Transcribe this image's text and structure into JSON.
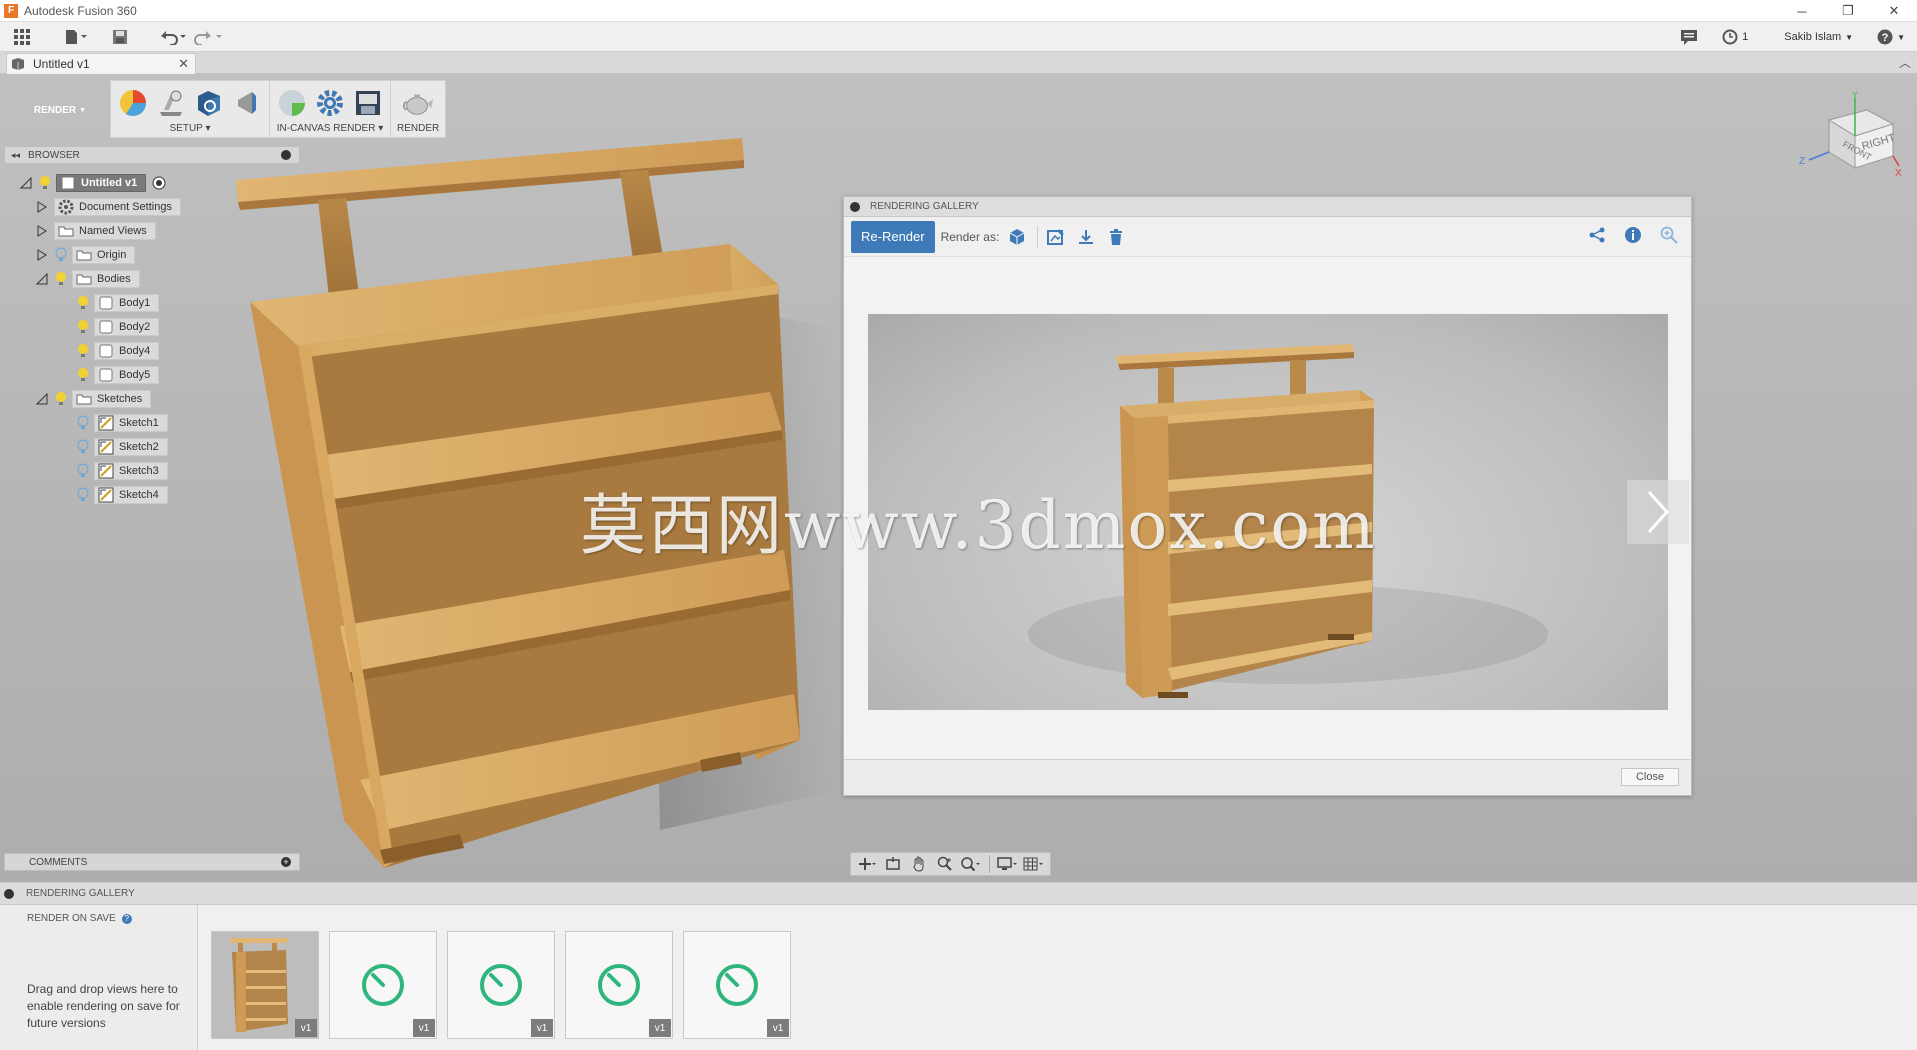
{
  "app": {
    "title": "Autodesk Fusion 360",
    "logo": "F"
  },
  "window_controls": {
    "minimize": "─",
    "restore": "❐",
    "close": "✕"
  },
  "quick_access": {
    "user": "Sakib Islam",
    "jobs_count": "1"
  },
  "document": {
    "tab_label": "Untitled v1"
  },
  "ribbon": {
    "workspace": "RENDER",
    "groups": [
      {
        "label": "SETUP"
      },
      {
        "label": "IN-CANVAS RENDER"
      },
      {
        "label": "RENDER"
      }
    ]
  },
  "browser": {
    "title": "BROWSER",
    "root": "Untitled v1",
    "items": [
      {
        "label": "Document Settings"
      },
      {
        "label": "Named Views"
      },
      {
        "label": "Origin"
      },
      {
        "label": "Bodies"
      },
      {
        "label": "Body1"
      },
      {
        "label": "Body2"
      },
      {
        "label": "Body4"
      },
      {
        "label": "Body5"
      },
      {
        "label": "Sketches"
      },
      {
        "label": "Sketch1"
      },
      {
        "label": "Sketch2"
      },
      {
        "label": "Sketch3"
      },
      {
        "label": "Sketch4"
      }
    ]
  },
  "comments": {
    "title": "COMMENTS"
  },
  "viewcube": {
    "face_right": "RIGHT",
    "face_front": "FRONT",
    "axis_z": "Z",
    "axis_x": "X",
    "axis_y": "Y"
  },
  "gallery_dialog": {
    "title": "RENDERING GALLERY",
    "rerender": "Re-Render",
    "render_as": "Render as:",
    "close": "Close"
  },
  "watermark": "莫西网www.3dmox.com",
  "strip": {
    "title": "RENDERING GALLERY",
    "render_on_save": "RENDER ON SAVE",
    "hint": "Drag and drop views here to enable rendering on save for future versions",
    "thumbs": [
      {
        "version": "v1"
      },
      {
        "version": "v1"
      },
      {
        "version": "v1"
      },
      {
        "version": "v1"
      },
      {
        "version": "v1"
      }
    ]
  },
  "colors": {
    "accent": "#3e7ab8",
    "wood": "#c99a52",
    "spinner": "#2fb57e"
  }
}
